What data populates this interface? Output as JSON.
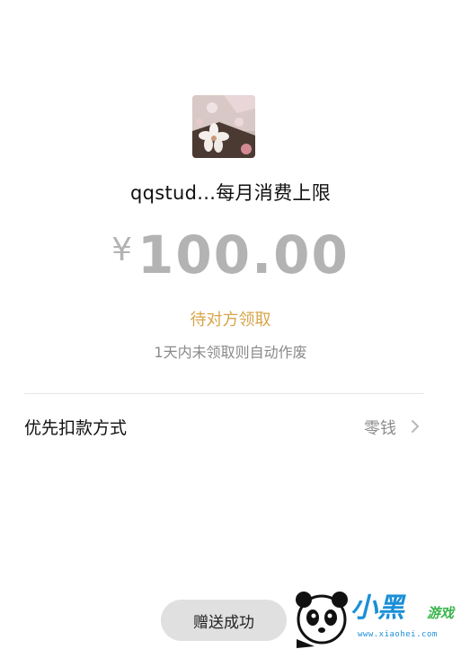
{
  "recipient": {
    "avatar_icon": "cherry-blossom-avatar",
    "name": "qqstud...每月消费上限"
  },
  "amount": {
    "currency": "¥",
    "value": "100.00",
    "color": "#b3b3b3"
  },
  "status": {
    "text": "待对方领取",
    "color": "#d7a54a",
    "expire_note": "1天内未领取则自动作废"
  },
  "payment": {
    "label": "优先扣款方式",
    "value": "零钱",
    "icon": "chevron-right-icon"
  },
  "action": {
    "label": "赠送成功"
  },
  "watermark": {
    "brand": "小黑",
    "sub": "游戏",
    "url": "www.xiaohei.com"
  }
}
